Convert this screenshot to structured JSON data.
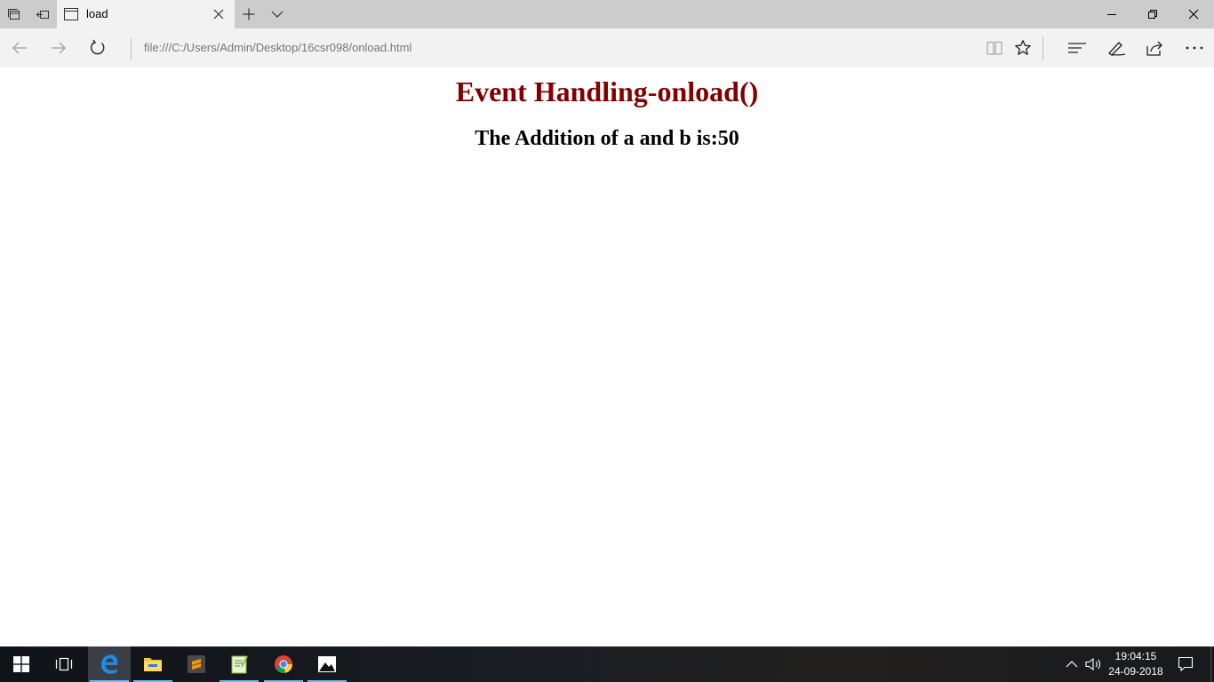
{
  "browser": {
    "tab": {
      "title": "load"
    },
    "address_bar": {
      "url": "file:///C:/Users/Admin/Desktop/16csr098/onload.html"
    }
  },
  "page": {
    "heading": "Event Handling-onload()",
    "result_text": "The Addition of a and b is:50"
  },
  "taskbar": {
    "clock": {
      "time": "19:04:15",
      "date": "24-09-2018"
    },
    "apps": [
      "start-icon",
      "task-view-icon",
      "edge-icon",
      "file-explorer-icon",
      "sublime-text-icon",
      "notepad-plus-icon",
      "chrome-icon",
      "photos-icon"
    ]
  },
  "colors": {
    "heading": "#800000",
    "tabbar": "#cccccc",
    "navbar": "#f2f2f2",
    "taskbar": "#101318",
    "taskbar_active_underline": "#76b9ed"
  }
}
